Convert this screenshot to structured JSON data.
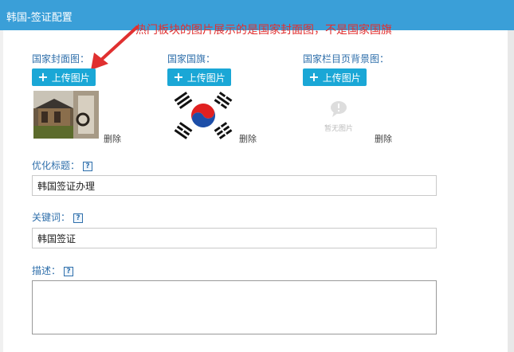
{
  "window": {
    "title": "韩国-签证配置"
  },
  "annotation": {
    "text": "热门板块的图片展示的是国家封面图，不是国家国旗",
    "color": "#e03030"
  },
  "cover": {
    "label": "国家封面图：",
    "upload": "上传图片",
    "delete": "删除"
  },
  "flag": {
    "label": "国家国旗：",
    "upload": "上传图片",
    "delete": "删除"
  },
  "banner": {
    "label": "国家栏目页背景图：",
    "upload": "上传图片",
    "delete": "删除",
    "placeholder": "暂无图片"
  },
  "seo_title": {
    "label": "优化标题：",
    "value": "韩国签证办理"
  },
  "keywords": {
    "label": "关键词：",
    "value": "韩国签证"
  },
  "description": {
    "label": "描述：",
    "value": ""
  },
  "help_glyph": "?",
  "colors": {
    "titlebar": "#3a9fd8",
    "button": "#1aa7d6",
    "label": "#2f6fab"
  }
}
